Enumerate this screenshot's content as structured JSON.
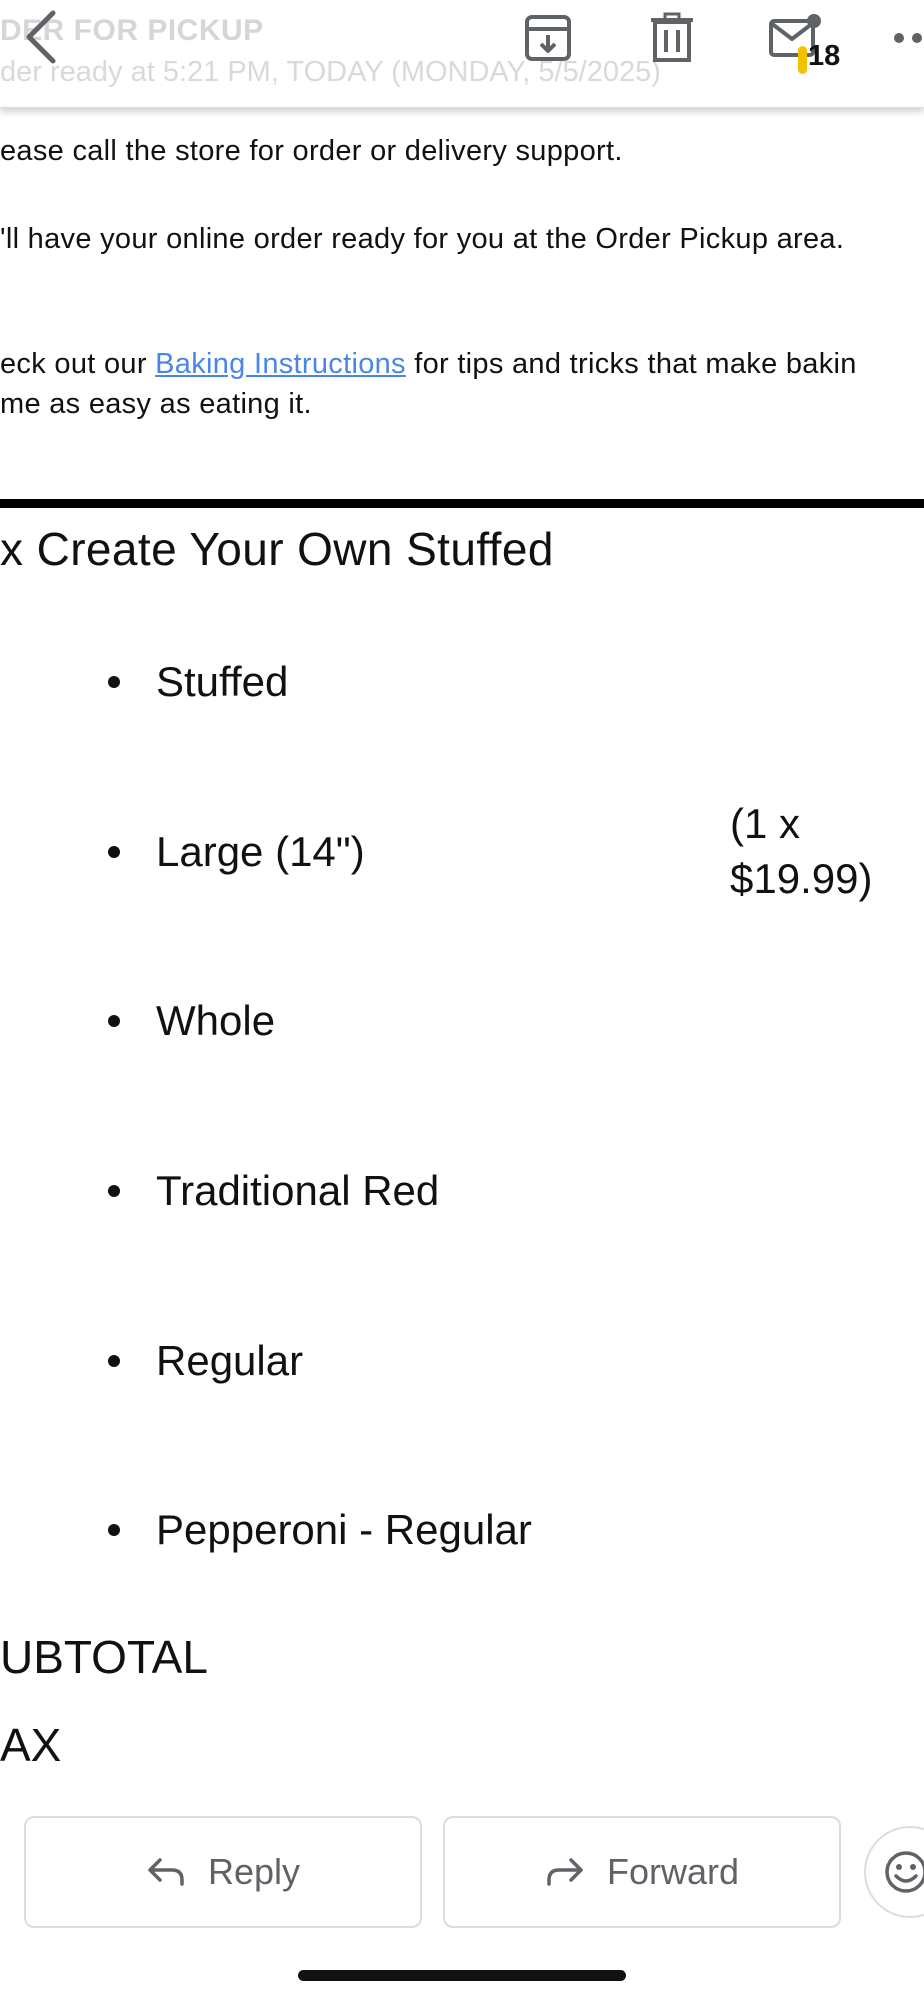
{
  "toolbar": {
    "faded_title": "DER FOR PICKUP",
    "faded_subtitle": "der ready at 5:21 PM, TODAY (MONDAY, 5/5/2025)",
    "back_icon": "chevron-left-icon",
    "archive_icon": "archive-icon",
    "trash_icon": "trash-icon",
    "mail_icon": "mail-unread-icon",
    "more_icon": "more-icon",
    "unread_count": "18",
    "badge_color": "#f2c200"
  },
  "message": {
    "support_line": "ease call the store for order or delivery support.",
    "ready_line": "'ll have your online order ready for you at the Order Pickup area.",
    "baking_prefix": "eck out our ",
    "baking_link": "Baking Instructions",
    "baking_suffix": " for tips and tricks that make bakin",
    "baking_line2": "me as easy as eating it.",
    "link_color": "#4a86e8"
  },
  "order": {
    "item_title": "x Create Your Own Stuffed",
    "options": [
      "Stuffed",
      "Large (14\")",
      "Whole",
      "Traditional Red",
      "Regular",
      "Pepperoni - Regular"
    ],
    "price_line1": "(1 x",
    "price_line2": "$19.99)",
    "subtotal_label": "UBTOTAL",
    "tax_label": "AX"
  },
  "actions": {
    "reply_label": "Reply",
    "forward_label": "Forward",
    "reply_icon": "reply-icon",
    "forward_icon": "forward-icon",
    "emoji_icon": "emoji-icon"
  }
}
